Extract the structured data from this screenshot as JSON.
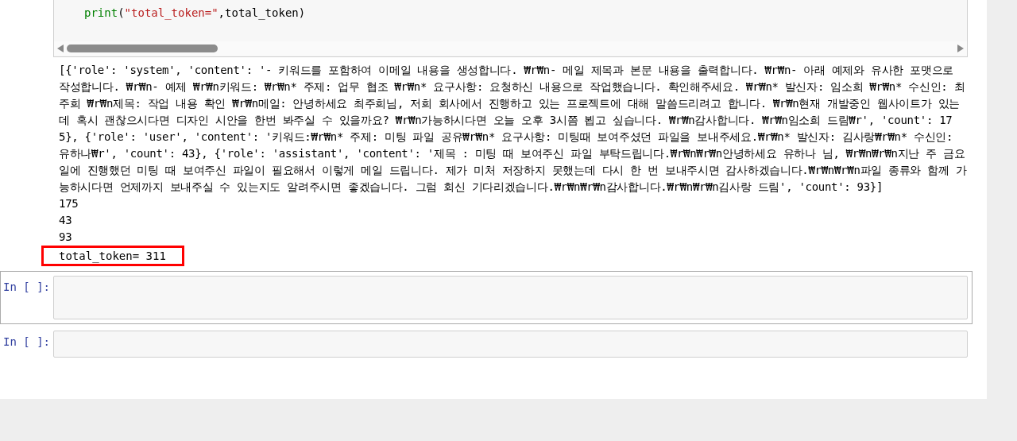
{
  "code_cell": {
    "tokens": [
      {
        "kind": "builtin",
        "text": "print"
      },
      {
        "kind": "plain",
        "text": "("
      },
      {
        "kind": "string",
        "text": "\"total_token=\""
      },
      {
        "kind": "plain",
        "text": ",total_token)"
      }
    ]
  },
  "output_lines": [
    {
      "text": "[{'role': 'system', 'content': '- 키워드를 포함하여 이메일 내용을 생성합니다. ₩r₩n- 메일 제목과 본문 내용을 출력합니다. ₩r₩n- 아래 예제와 유사한 포맷으로 작성합니다. ₩r₩n- 예제 ₩r₩n키워드: ₩r₩n* 주제: 업무 협조 ₩r₩n* 요구사항: 요청하신 내용으로 작업했습니다. 확인해주세요. ₩r₩n* 발신자: 임소희 ₩r₩n* 수신인: 최주희 ₩r₩n제목: 작업 내용 확인 ₩r₩n메일: 안녕하세요 최주희님, 저희 회사에서 진행하고 있는 프로젝트에 대해 말씀드리려고 합니다. ₩r₩n현재 개발중인 웹사이트가 있는데 혹시 괜찮으시다면 디자인 시안을 한번 봐주실 수 있을까요? ₩r₩n가능하시다면 오늘 오후 3시쯤 뵙고 싶습니다. ₩r₩n감사합니다. ₩r₩n임소희 드림₩r', 'count': 175}, {'role': 'user', 'content': '키워드:₩r₩n* 주제: 미팅 파일 공유₩r₩n* 요구사항: 미팅때 보여주셨던 파일을 보내주세요.₩r₩n* 발신자: 김사랑₩r₩n* 수신인: 유하나₩r', 'count': 43}, {'role': 'assistant', 'content': '제목 : 미팅 때 보여주신 파일 부탁드립니다.₩r₩n₩r₩n안녕하세요 유하나 님, ₩r₩n₩r₩n지난 주 금요일에 진행했던 미팅 때 보여주신 파일이 필요해서 이렇게 메일 드립니다. 제가 미처 저장하지 못했는데 다시 한 번 보내주시면 감사하겠습니다.₩r₩n₩r₩n파일 종류와 함께 가능하시다면 언제까지 보내주실 수 있는지도 알려주시면 좋겠습니다. 그럼 회신 기다리겠습니다.₩r₩n₩r₩n감사합니다.₩r₩n₩r₩n김사랑 드림', 'count': 93}]",
      "highlighted": false
    },
    {
      "text": "175",
      "highlighted": false
    },
    {
      "text": "43",
      "highlighted": false
    },
    {
      "text": "93",
      "highlighted": false
    },
    {
      "text": "total_token= 311",
      "highlighted": true
    }
  ],
  "empty_cells": [
    {
      "prompt": "In [ ]:",
      "selected": true
    },
    {
      "prompt": "In [ ]:",
      "selected": false
    }
  ]
}
